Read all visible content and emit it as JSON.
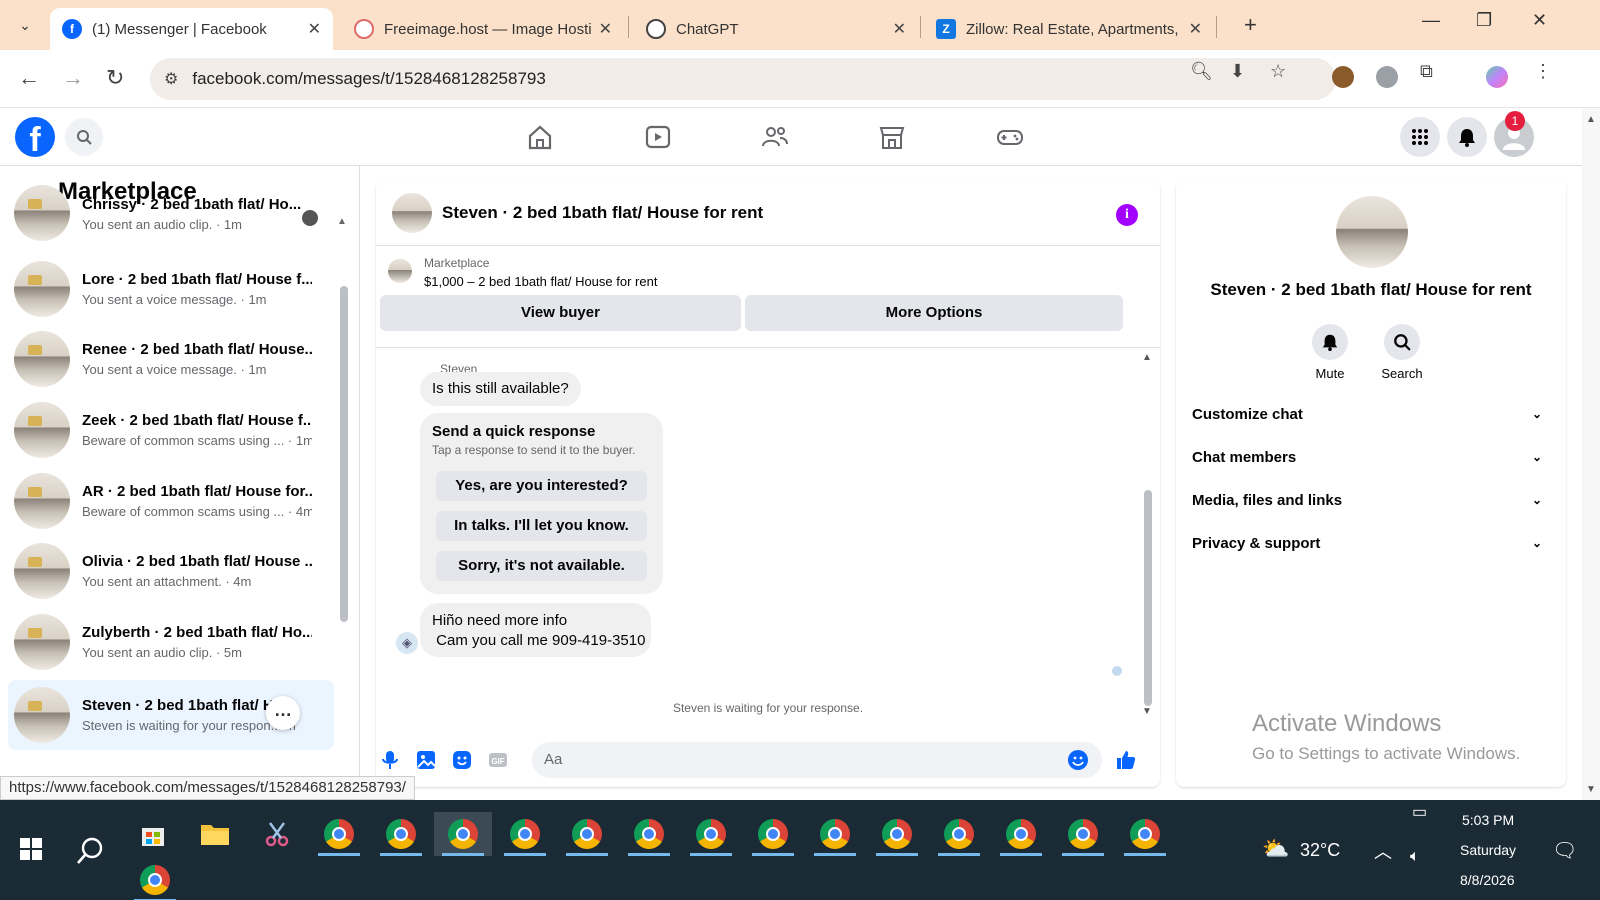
{
  "browser": {
    "tabs": [
      {
        "title": "(1) Messenger | Facebook",
        "active": true
      },
      {
        "title": "Freeimage.host — Image Hostin",
        "active": false
      },
      {
        "title": "ChatGPT",
        "active": false
      },
      {
        "title": "Zillow: Real Estate, Apartments,",
        "active": false
      }
    ],
    "url": "facebook.com/messages/t/1528468128258793",
    "status_url": "https://www.facebook.com/messages/t/1528468128258793/"
  },
  "header": {
    "notification_count": "1"
  },
  "sidebar": {
    "title": "Marketplace",
    "conversations": [
      {
        "name": "Chrissy · 2 bed 1bath flat/ Ho...",
        "preview": "You sent an audio clip. · 1m"
      },
      {
        "name": "Lore · 2 bed 1bath flat/ House f...",
        "preview": "You sent a voice message. · 1m"
      },
      {
        "name": "Renee · 2 bed 1bath flat/ House...",
        "preview": "You sent a voice message. · 1m"
      },
      {
        "name": "Zeek · 2 bed 1bath flat/ House f...",
        "preview": "Beware of common scams using ... · 1m"
      },
      {
        "name": "AR · 2 bed 1bath flat/ House for...",
        "preview": "Beware of common scams using ... · 4m"
      },
      {
        "name": "Olivia · 2 bed 1bath flat/ House ...",
        "preview": "You sent an attachment. · 4m"
      },
      {
        "name": "Zulyberth · 2 bed 1bath flat/ Ho...",
        "preview": "You sent an audio clip. · 5m"
      },
      {
        "name": "Steven · 2 bed 1bath flat/ Ho...",
        "preview": "Steven is waiting for your respon... m"
      }
    ]
  },
  "chat": {
    "title": "Steven · 2 bed 1bath flat/ House for rent",
    "marketplace_label": "Marketplace",
    "listing": "$1,000 – 2 bed 1bath flat/ House for rent",
    "view_buyer": "View buyer",
    "more_options": "More Options",
    "sender_name": "Steven",
    "message1": "Is this still available?",
    "quick_title": "Send a quick response",
    "quick_sub": "Tap a response to send it to the buyer.",
    "quick_replies": [
      "Yes, are you interested?",
      "In talks. I'll let you know.",
      "Sorry, it's not available."
    ],
    "message2_line1": "Hiño need more info",
    "message2_line2": " Cam you call me 909-419-3510",
    "waiting": "Steven is waiting for your response.",
    "input_placeholder": "Aa"
  },
  "info_panel": {
    "name": "Steven · 2 bed 1bath flat/ House for rent",
    "mute": "Mute",
    "search": "Search",
    "rows": [
      "Customize chat",
      "Chat members",
      "Media, files and links",
      "Privacy & support"
    ],
    "activate_title": "Activate Windows",
    "activate_sub": "Go to Settings to activate Windows."
  },
  "taskbar": {
    "temperature": "32°C",
    "time": "5:03 PM",
    "day": "Saturday",
    "date": "8/8/2026"
  }
}
